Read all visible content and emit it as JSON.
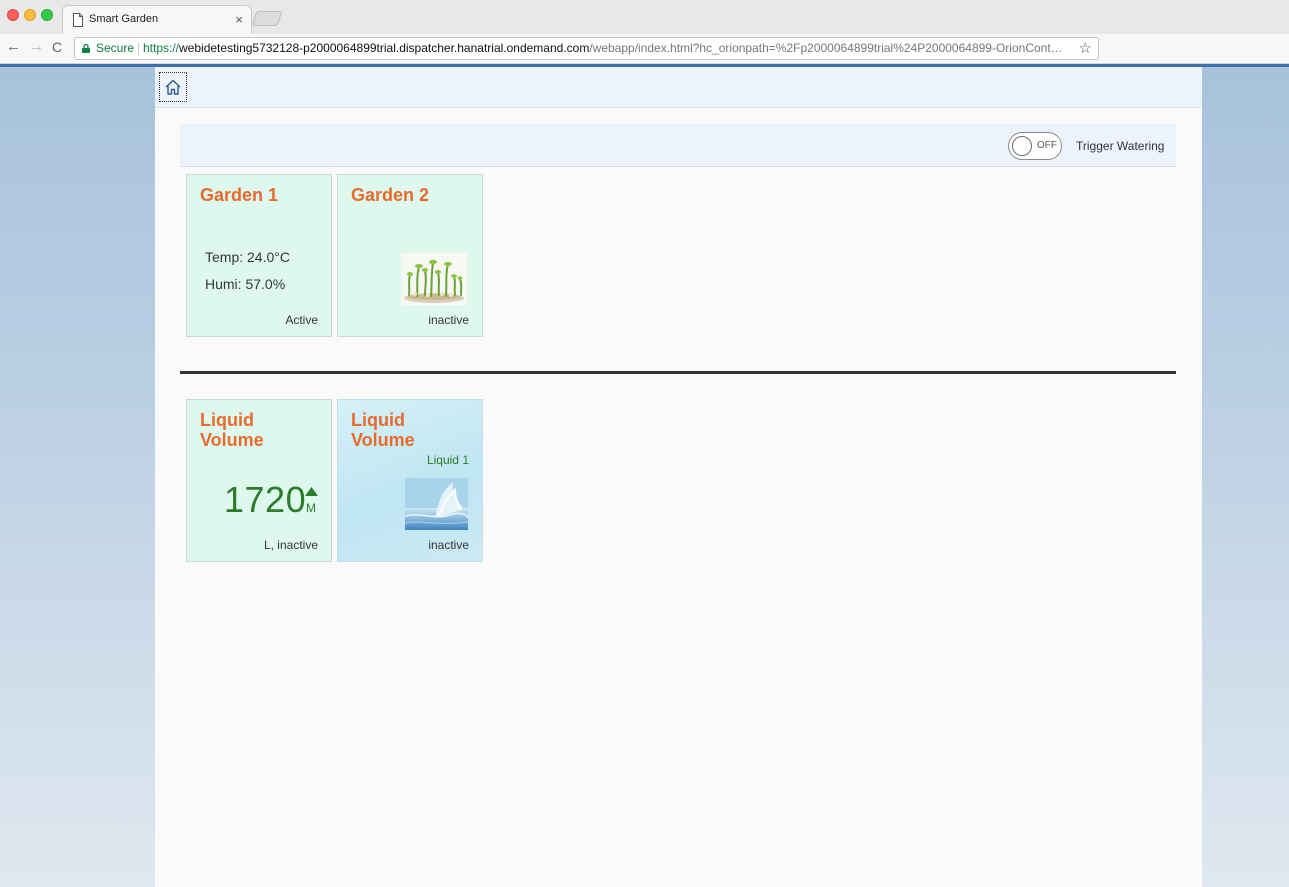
{
  "browser": {
    "tab_title": "Smart Garden",
    "tab_close": "×",
    "secure_label": "Secure",
    "url_scheme": "https://",
    "url_host": "webidetesting5732128-p2000064899trial.dispatcher.hanatrial.ondemand.com",
    "url_path": "/webapp/index.html?hc_orionpath=%2Fp2000064899trial%24P2000064899-OrionCont…",
    "back_glyph": "←",
    "forward_glyph": "→",
    "reload_glyph": "C",
    "star_glyph": "☆"
  },
  "header": {
    "home_icon": "home-icon"
  },
  "toolbar": {
    "switch_state": "OFF",
    "trigger_label": "Trigger Watering"
  },
  "gardens": [
    {
      "title": "Garden 1",
      "temp": "Temp: 24.0°C",
      "humi": "Humi: 57.0%",
      "status": "Active"
    },
    {
      "title": "Garden 2",
      "image": "plant-sprouts-image",
      "status": "inactive"
    }
  ],
  "liquids": [
    {
      "title": "Liquid Volume",
      "value": "1720",
      "trend": "up",
      "scale": "M",
      "footer": "L, inactive"
    },
    {
      "title": "Liquid Volume",
      "subtitle": "Liquid 1",
      "image": "water-splash-image",
      "status": "inactive"
    }
  ],
  "colors": {
    "tile_title": "#e86b2e",
    "kpi_green": "#2b7c2b",
    "tile_bg": "#dff8ee",
    "header_bg": "#edf3fa",
    "secure_green": "#0b8043"
  }
}
